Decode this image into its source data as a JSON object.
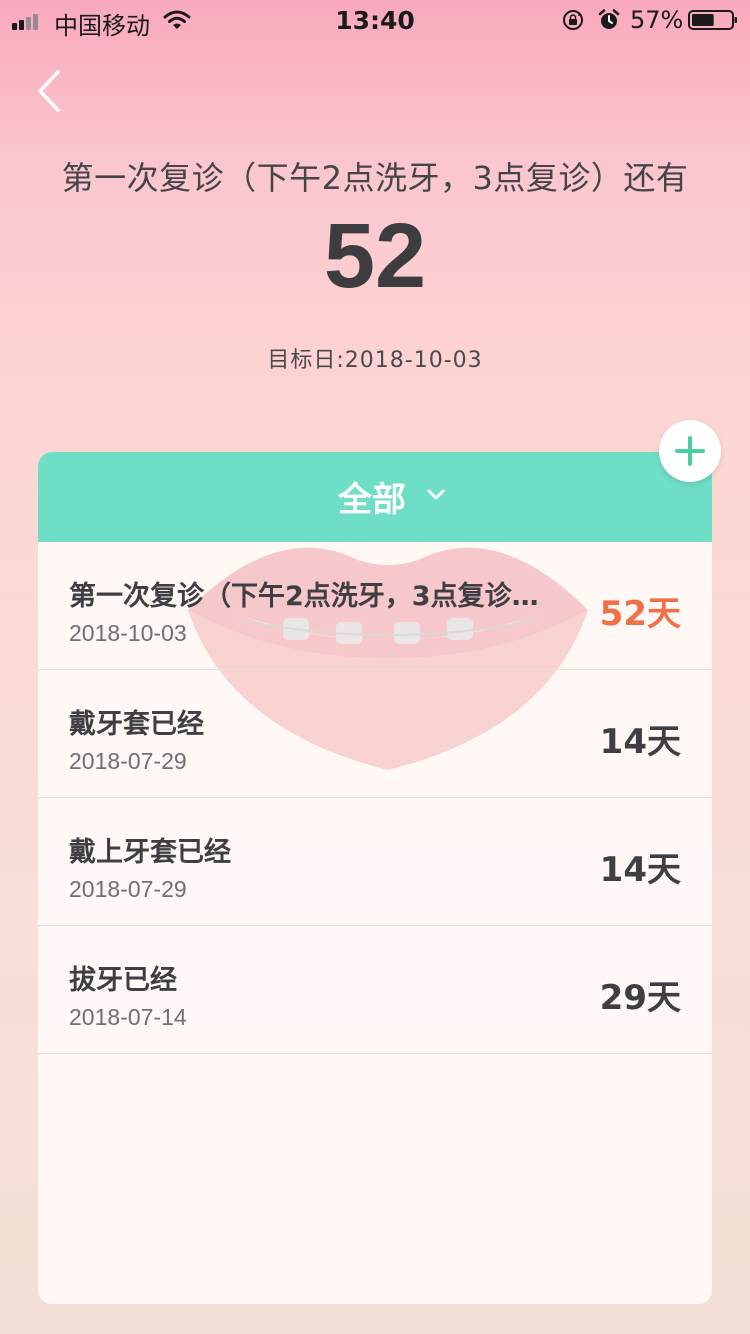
{
  "status_bar": {
    "carrier": "中国移动",
    "time": "13:40",
    "battery_percent": "57%",
    "battery_level": 0.57
  },
  "header": {
    "title": "第一次复诊（下午2点洗牙，3点复诊）还有",
    "days": "52",
    "target_date": "目标日:2018-10-03"
  },
  "filter": {
    "label": "全部"
  },
  "colors": {
    "accent": "#6fdec6",
    "highlight": "#f07048"
  },
  "events": [
    {
      "name": "第一次复诊（下午2点洗牙，3点复诊）还有",
      "date": "2018-10-03",
      "days": "52天",
      "highlight": true
    },
    {
      "name": "戴牙套已经",
      "date": "2018-07-29",
      "days": "14天",
      "highlight": false
    },
    {
      "name": "戴上牙套已经",
      "date": "2018-07-29",
      "days": "14天",
      "highlight": false
    },
    {
      "name": "拔牙已经",
      "date": "2018-07-14",
      "days": "29天",
      "highlight": false
    }
  ]
}
